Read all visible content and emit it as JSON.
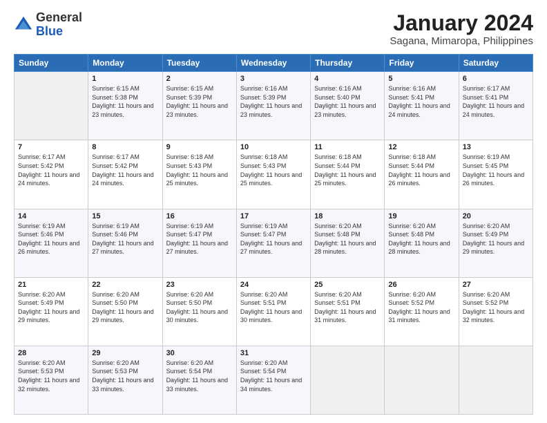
{
  "header": {
    "logo_general": "General",
    "logo_blue": "Blue",
    "month": "January 2024",
    "location": "Sagana, Mimaropa, Philippines"
  },
  "days_of_week": [
    "Sunday",
    "Monday",
    "Tuesday",
    "Wednesday",
    "Thursday",
    "Friday",
    "Saturday"
  ],
  "weeks": [
    [
      {
        "day": "",
        "sunrise": "",
        "sunset": "",
        "daylight": ""
      },
      {
        "day": "1",
        "sunrise": "Sunrise: 6:15 AM",
        "sunset": "Sunset: 5:38 PM",
        "daylight": "Daylight: 11 hours and 23 minutes."
      },
      {
        "day": "2",
        "sunrise": "Sunrise: 6:15 AM",
        "sunset": "Sunset: 5:39 PM",
        "daylight": "Daylight: 11 hours and 23 minutes."
      },
      {
        "day": "3",
        "sunrise": "Sunrise: 6:16 AM",
        "sunset": "Sunset: 5:39 PM",
        "daylight": "Daylight: 11 hours and 23 minutes."
      },
      {
        "day": "4",
        "sunrise": "Sunrise: 6:16 AM",
        "sunset": "Sunset: 5:40 PM",
        "daylight": "Daylight: 11 hours and 23 minutes."
      },
      {
        "day": "5",
        "sunrise": "Sunrise: 6:16 AM",
        "sunset": "Sunset: 5:41 PM",
        "daylight": "Daylight: 11 hours and 24 minutes."
      },
      {
        "day": "6",
        "sunrise": "Sunrise: 6:17 AM",
        "sunset": "Sunset: 5:41 PM",
        "daylight": "Daylight: 11 hours and 24 minutes."
      }
    ],
    [
      {
        "day": "7",
        "sunrise": "Sunrise: 6:17 AM",
        "sunset": "Sunset: 5:42 PM",
        "daylight": "Daylight: 11 hours and 24 minutes."
      },
      {
        "day": "8",
        "sunrise": "Sunrise: 6:17 AM",
        "sunset": "Sunset: 5:42 PM",
        "daylight": "Daylight: 11 hours and 24 minutes."
      },
      {
        "day": "9",
        "sunrise": "Sunrise: 6:18 AM",
        "sunset": "Sunset: 5:43 PM",
        "daylight": "Daylight: 11 hours and 25 minutes."
      },
      {
        "day": "10",
        "sunrise": "Sunrise: 6:18 AM",
        "sunset": "Sunset: 5:43 PM",
        "daylight": "Daylight: 11 hours and 25 minutes."
      },
      {
        "day": "11",
        "sunrise": "Sunrise: 6:18 AM",
        "sunset": "Sunset: 5:44 PM",
        "daylight": "Daylight: 11 hours and 25 minutes."
      },
      {
        "day": "12",
        "sunrise": "Sunrise: 6:18 AM",
        "sunset": "Sunset: 5:44 PM",
        "daylight": "Daylight: 11 hours and 26 minutes."
      },
      {
        "day": "13",
        "sunrise": "Sunrise: 6:19 AM",
        "sunset": "Sunset: 5:45 PM",
        "daylight": "Daylight: 11 hours and 26 minutes."
      }
    ],
    [
      {
        "day": "14",
        "sunrise": "Sunrise: 6:19 AM",
        "sunset": "Sunset: 5:46 PM",
        "daylight": "Daylight: 11 hours and 26 minutes."
      },
      {
        "day": "15",
        "sunrise": "Sunrise: 6:19 AM",
        "sunset": "Sunset: 5:46 PM",
        "daylight": "Daylight: 11 hours and 27 minutes."
      },
      {
        "day": "16",
        "sunrise": "Sunrise: 6:19 AM",
        "sunset": "Sunset: 5:47 PM",
        "daylight": "Daylight: 11 hours and 27 minutes."
      },
      {
        "day": "17",
        "sunrise": "Sunrise: 6:19 AM",
        "sunset": "Sunset: 5:47 PM",
        "daylight": "Daylight: 11 hours and 27 minutes."
      },
      {
        "day": "18",
        "sunrise": "Sunrise: 6:20 AM",
        "sunset": "Sunset: 5:48 PM",
        "daylight": "Daylight: 11 hours and 28 minutes."
      },
      {
        "day": "19",
        "sunrise": "Sunrise: 6:20 AM",
        "sunset": "Sunset: 5:48 PM",
        "daylight": "Daylight: 11 hours and 28 minutes."
      },
      {
        "day": "20",
        "sunrise": "Sunrise: 6:20 AM",
        "sunset": "Sunset: 5:49 PM",
        "daylight": "Daylight: 11 hours and 29 minutes."
      }
    ],
    [
      {
        "day": "21",
        "sunrise": "Sunrise: 6:20 AM",
        "sunset": "Sunset: 5:49 PM",
        "daylight": "Daylight: 11 hours and 29 minutes."
      },
      {
        "day": "22",
        "sunrise": "Sunrise: 6:20 AM",
        "sunset": "Sunset: 5:50 PM",
        "daylight": "Daylight: 11 hours and 29 minutes."
      },
      {
        "day": "23",
        "sunrise": "Sunrise: 6:20 AM",
        "sunset": "Sunset: 5:50 PM",
        "daylight": "Daylight: 11 hours and 30 minutes."
      },
      {
        "day": "24",
        "sunrise": "Sunrise: 6:20 AM",
        "sunset": "Sunset: 5:51 PM",
        "daylight": "Daylight: 11 hours and 30 minutes."
      },
      {
        "day": "25",
        "sunrise": "Sunrise: 6:20 AM",
        "sunset": "Sunset: 5:51 PM",
        "daylight": "Daylight: 11 hours and 31 minutes."
      },
      {
        "day": "26",
        "sunrise": "Sunrise: 6:20 AM",
        "sunset": "Sunset: 5:52 PM",
        "daylight": "Daylight: 11 hours and 31 minutes."
      },
      {
        "day": "27",
        "sunrise": "Sunrise: 6:20 AM",
        "sunset": "Sunset: 5:52 PM",
        "daylight": "Daylight: 11 hours and 32 minutes."
      }
    ],
    [
      {
        "day": "28",
        "sunrise": "Sunrise: 6:20 AM",
        "sunset": "Sunset: 5:53 PM",
        "daylight": "Daylight: 11 hours and 32 minutes."
      },
      {
        "day": "29",
        "sunrise": "Sunrise: 6:20 AM",
        "sunset": "Sunset: 5:53 PM",
        "daylight": "Daylight: 11 hours and 33 minutes."
      },
      {
        "day": "30",
        "sunrise": "Sunrise: 6:20 AM",
        "sunset": "Sunset: 5:54 PM",
        "daylight": "Daylight: 11 hours and 33 minutes."
      },
      {
        "day": "31",
        "sunrise": "Sunrise: 6:20 AM",
        "sunset": "Sunset: 5:54 PM",
        "daylight": "Daylight: 11 hours and 34 minutes."
      },
      {
        "day": "",
        "sunrise": "",
        "sunset": "",
        "daylight": ""
      },
      {
        "day": "",
        "sunrise": "",
        "sunset": "",
        "daylight": ""
      },
      {
        "day": "",
        "sunrise": "",
        "sunset": "",
        "daylight": ""
      }
    ]
  ]
}
